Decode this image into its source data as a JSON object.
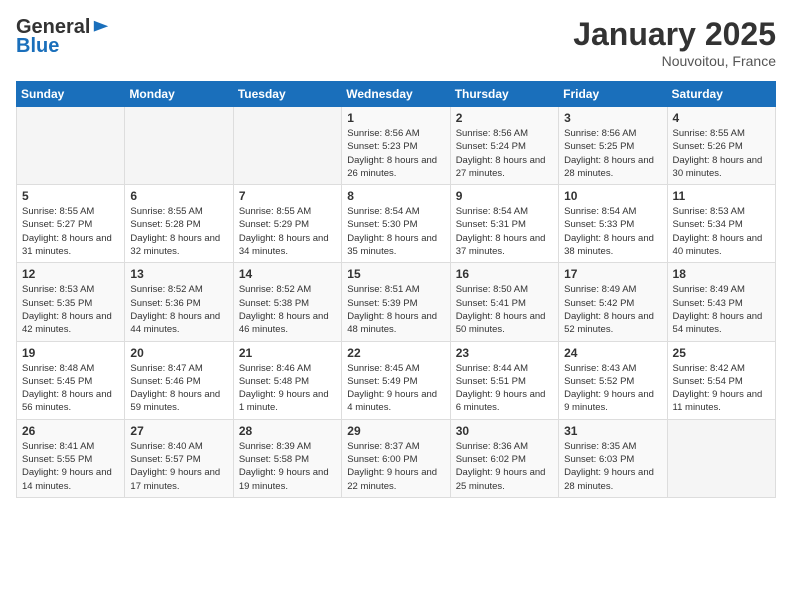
{
  "header": {
    "logo_general": "General",
    "logo_blue": "Blue",
    "month_title": "January 2025",
    "location": "Nouvoitou, France"
  },
  "weekdays": [
    "Sunday",
    "Monday",
    "Tuesday",
    "Wednesday",
    "Thursday",
    "Friday",
    "Saturday"
  ],
  "weeks": [
    [
      {
        "day": "",
        "info": ""
      },
      {
        "day": "",
        "info": ""
      },
      {
        "day": "",
        "info": ""
      },
      {
        "day": "1",
        "info": "Sunrise: 8:56 AM\nSunset: 5:23 PM\nDaylight: 8 hours and 26 minutes."
      },
      {
        "day": "2",
        "info": "Sunrise: 8:56 AM\nSunset: 5:24 PM\nDaylight: 8 hours and 27 minutes."
      },
      {
        "day": "3",
        "info": "Sunrise: 8:56 AM\nSunset: 5:25 PM\nDaylight: 8 hours and 28 minutes."
      },
      {
        "day": "4",
        "info": "Sunrise: 8:55 AM\nSunset: 5:26 PM\nDaylight: 8 hours and 30 minutes."
      }
    ],
    [
      {
        "day": "5",
        "info": "Sunrise: 8:55 AM\nSunset: 5:27 PM\nDaylight: 8 hours and 31 minutes."
      },
      {
        "day": "6",
        "info": "Sunrise: 8:55 AM\nSunset: 5:28 PM\nDaylight: 8 hours and 32 minutes."
      },
      {
        "day": "7",
        "info": "Sunrise: 8:55 AM\nSunset: 5:29 PM\nDaylight: 8 hours and 34 minutes."
      },
      {
        "day": "8",
        "info": "Sunrise: 8:54 AM\nSunset: 5:30 PM\nDaylight: 8 hours and 35 minutes."
      },
      {
        "day": "9",
        "info": "Sunrise: 8:54 AM\nSunset: 5:31 PM\nDaylight: 8 hours and 37 minutes."
      },
      {
        "day": "10",
        "info": "Sunrise: 8:54 AM\nSunset: 5:33 PM\nDaylight: 8 hours and 38 minutes."
      },
      {
        "day": "11",
        "info": "Sunrise: 8:53 AM\nSunset: 5:34 PM\nDaylight: 8 hours and 40 minutes."
      }
    ],
    [
      {
        "day": "12",
        "info": "Sunrise: 8:53 AM\nSunset: 5:35 PM\nDaylight: 8 hours and 42 minutes."
      },
      {
        "day": "13",
        "info": "Sunrise: 8:52 AM\nSunset: 5:36 PM\nDaylight: 8 hours and 44 minutes."
      },
      {
        "day": "14",
        "info": "Sunrise: 8:52 AM\nSunset: 5:38 PM\nDaylight: 8 hours and 46 minutes."
      },
      {
        "day": "15",
        "info": "Sunrise: 8:51 AM\nSunset: 5:39 PM\nDaylight: 8 hours and 48 minutes."
      },
      {
        "day": "16",
        "info": "Sunrise: 8:50 AM\nSunset: 5:41 PM\nDaylight: 8 hours and 50 minutes."
      },
      {
        "day": "17",
        "info": "Sunrise: 8:49 AM\nSunset: 5:42 PM\nDaylight: 8 hours and 52 minutes."
      },
      {
        "day": "18",
        "info": "Sunrise: 8:49 AM\nSunset: 5:43 PM\nDaylight: 8 hours and 54 minutes."
      }
    ],
    [
      {
        "day": "19",
        "info": "Sunrise: 8:48 AM\nSunset: 5:45 PM\nDaylight: 8 hours and 56 minutes."
      },
      {
        "day": "20",
        "info": "Sunrise: 8:47 AM\nSunset: 5:46 PM\nDaylight: 8 hours and 59 minutes."
      },
      {
        "day": "21",
        "info": "Sunrise: 8:46 AM\nSunset: 5:48 PM\nDaylight: 9 hours and 1 minute."
      },
      {
        "day": "22",
        "info": "Sunrise: 8:45 AM\nSunset: 5:49 PM\nDaylight: 9 hours and 4 minutes."
      },
      {
        "day": "23",
        "info": "Sunrise: 8:44 AM\nSunset: 5:51 PM\nDaylight: 9 hours and 6 minutes."
      },
      {
        "day": "24",
        "info": "Sunrise: 8:43 AM\nSunset: 5:52 PM\nDaylight: 9 hours and 9 minutes."
      },
      {
        "day": "25",
        "info": "Sunrise: 8:42 AM\nSunset: 5:54 PM\nDaylight: 9 hours and 11 minutes."
      }
    ],
    [
      {
        "day": "26",
        "info": "Sunrise: 8:41 AM\nSunset: 5:55 PM\nDaylight: 9 hours and 14 minutes."
      },
      {
        "day": "27",
        "info": "Sunrise: 8:40 AM\nSunset: 5:57 PM\nDaylight: 9 hours and 17 minutes."
      },
      {
        "day": "28",
        "info": "Sunrise: 8:39 AM\nSunset: 5:58 PM\nDaylight: 9 hours and 19 minutes."
      },
      {
        "day": "29",
        "info": "Sunrise: 8:37 AM\nSunset: 6:00 PM\nDaylight: 9 hours and 22 minutes."
      },
      {
        "day": "30",
        "info": "Sunrise: 8:36 AM\nSunset: 6:02 PM\nDaylight: 9 hours and 25 minutes."
      },
      {
        "day": "31",
        "info": "Sunrise: 8:35 AM\nSunset: 6:03 PM\nDaylight: 9 hours and 28 minutes."
      },
      {
        "day": "",
        "info": ""
      }
    ]
  ]
}
